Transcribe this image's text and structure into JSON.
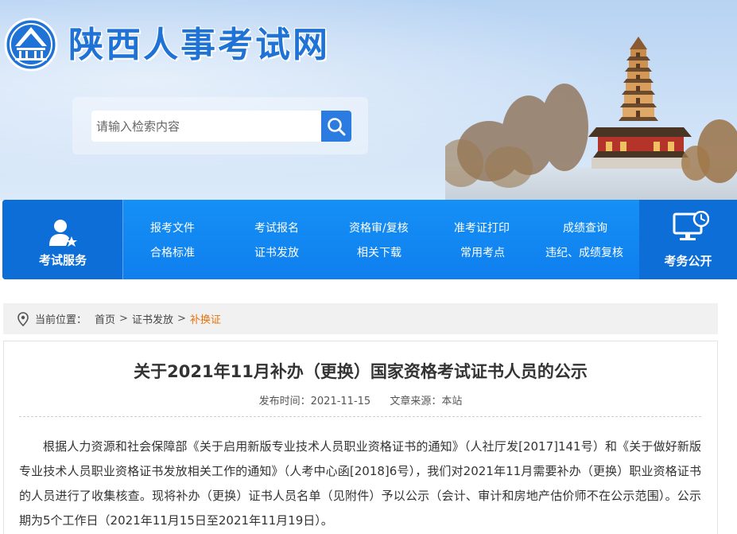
{
  "header": {
    "site_title": "陕西人事考试网",
    "search_placeholder": "请输入检索内容"
  },
  "nav": {
    "service_label": "考试服务",
    "links_row1": [
      "报考文件",
      "考试报名",
      "资格审/复核",
      "准考证打印",
      "成绩查询"
    ],
    "links_row2": [
      "合格标准",
      "证书发放",
      "相关下载",
      "常用考点",
      "违纪、成绩复核"
    ],
    "open_label": "考务公开"
  },
  "breadcrumb": {
    "prefix": "当前位置：",
    "items": [
      "首页",
      "证书发放",
      "补换证"
    ],
    "separator": ">"
  },
  "article": {
    "title": "关于2021年11月补办（更换）国家资格考试证书人员的公示",
    "publish_label": "发布时间：",
    "publish_date": "2021-11-15",
    "source_label": "文章来源：",
    "source": "本站",
    "body": "根据人力资源和社会保障部《关于启用新版专业技术人员职业资格证书的通知》（人社厅发[2017]141号）和《关于做好新版专业技术人员职业资格证书发放相关工作的通知》（人考中心函[2018]6号），我们对2021年11月需要补办（更换）职业资格证书的人员进行了收集核查。现将补办（更换）证书人员名单（见附件）予以公示（会计、审计和房地产估价师不在公示范围）。公示期为5个工作日（2021年11月15日至2021年11月19日）。"
  },
  "colors": {
    "brand_blue": "#1f73d6",
    "nav_blue": "#1590f5",
    "nav_dark": "#0e6ed8",
    "breadcrumb_current": "#e8730c"
  }
}
